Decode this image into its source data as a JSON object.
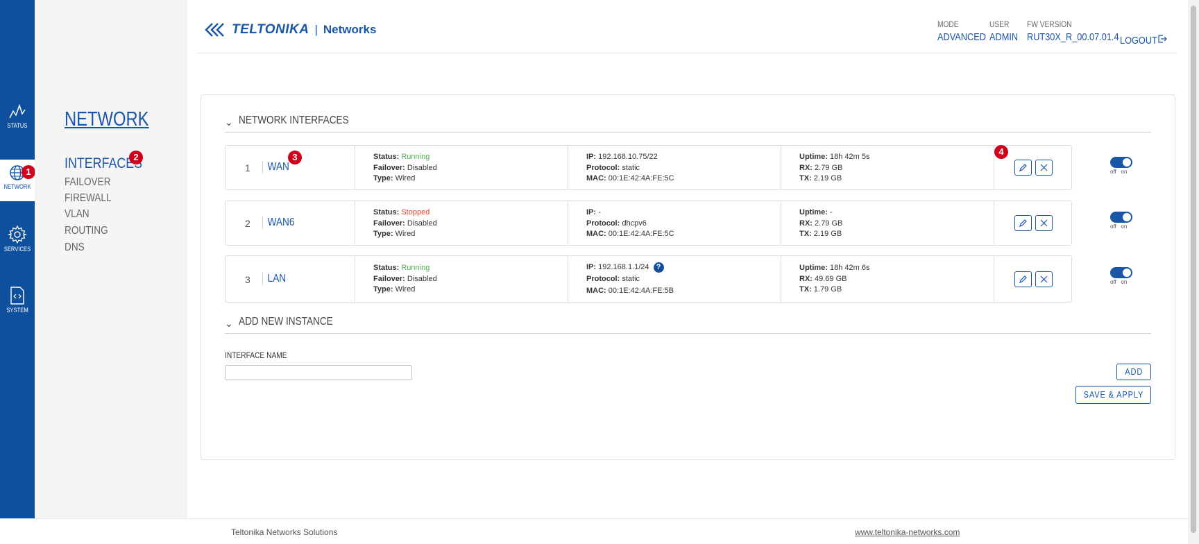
{
  "rail": {
    "items": [
      {
        "label": "STATUS",
        "icon": "status-icon"
      },
      {
        "label": "NETWORK",
        "icon": "globe-icon"
      },
      {
        "label": "SERVICES",
        "icon": "gear-icon"
      },
      {
        "label": "SYSTEM",
        "icon": "code-file-icon"
      }
    ]
  },
  "submenu": {
    "title": "NETWORK",
    "items": [
      "INTERFACES",
      "FAILOVER",
      "FIREWALL",
      "VLAN",
      "ROUTING",
      "DNS"
    ]
  },
  "badges": [
    "1",
    "2",
    "3",
    "4"
  ],
  "header": {
    "brand": "TELTONIKA",
    "separator": "|",
    "networks": "Networks",
    "mode_label": "MODE",
    "mode_value": "ADVANCED",
    "user_label": "USER",
    "user_value": "ADMIN",
    "fw_label": "FW VERSION",
    "fw_value": "RUT30X_R_00.07.01.4",
    "logout": "LOGOUT"
  },
  "sections": {
    "interfaces": "NETWORK INTERFACES",
    "add": "ADD NEW INSTANCE"
  },
  "interfaces": [
    {
      "num": "1",
      "name": "WAN",
      "status": "Running",
      "failover": "Disabled",
      "type": "Wired",
      "ip": "192.168.10.75/22",
      "protocol": "static",
      "mac": "00:1E:42:4A:FE:5C",
      "uptime": "18h 42m 5s",
      "rx": "2.79 GB",
      "tx": "2.19 GB"
    },
    {
      "num": "2",
      "name": "WAN6",
      "status": "Stopped",
      "failover": "Disabled",
      "type": "Wired",
      "ip": "-",
      "protocol": "dhcpv6",
      "mac": "00:1E:42:4A:FE:5C",
      "uptime": "-",
      "rx": "2.79 GB",
      "tx": "2.19 GB"
    },
    {
      "num": "3",
      "name": "LAN",
      "status": "Running",
      "failover": "Disabled",
      "type": "Wired",
      "ip": "192.168.1.1/24",
      "protocol": "static",
      "mac": "00:1E:42:4A:FE:5B",
      "uptime": "18h 42m 6s",
      "rx": "49.69 GB",
      "tx": "1.79 GB"
    }
  ],
  "labels": {
    "status": "Status:",
    "failover": "Failover:",
    "type": "Type:",
    "ip": "IP:",
    "protocol": "Protocol:",
    "mac": "MAC:",
    "uptime": "Uptime:",
    "rx": "RX:",
    "tx": "TX:",
    "off": "off",
    "on": "on",
    "help": "?"
  },
  "form": {
    "interface_name_label": "INTERFACE NAME",
    "interface_name_value": "",
    "add_button": "ADD",
    "save_button": "SAVE & APPLY"
  },
  "footer": {
    "left": "Teltonika Networks Solutions",
    "right": "www.teltonika-networks.com"
  },
  "colors": {
    "brand": "#0e4f9e",
    "running": "#4caf50",
    "stopped": "#e0432f",
    "badge": "#d0021b"
  }
}
